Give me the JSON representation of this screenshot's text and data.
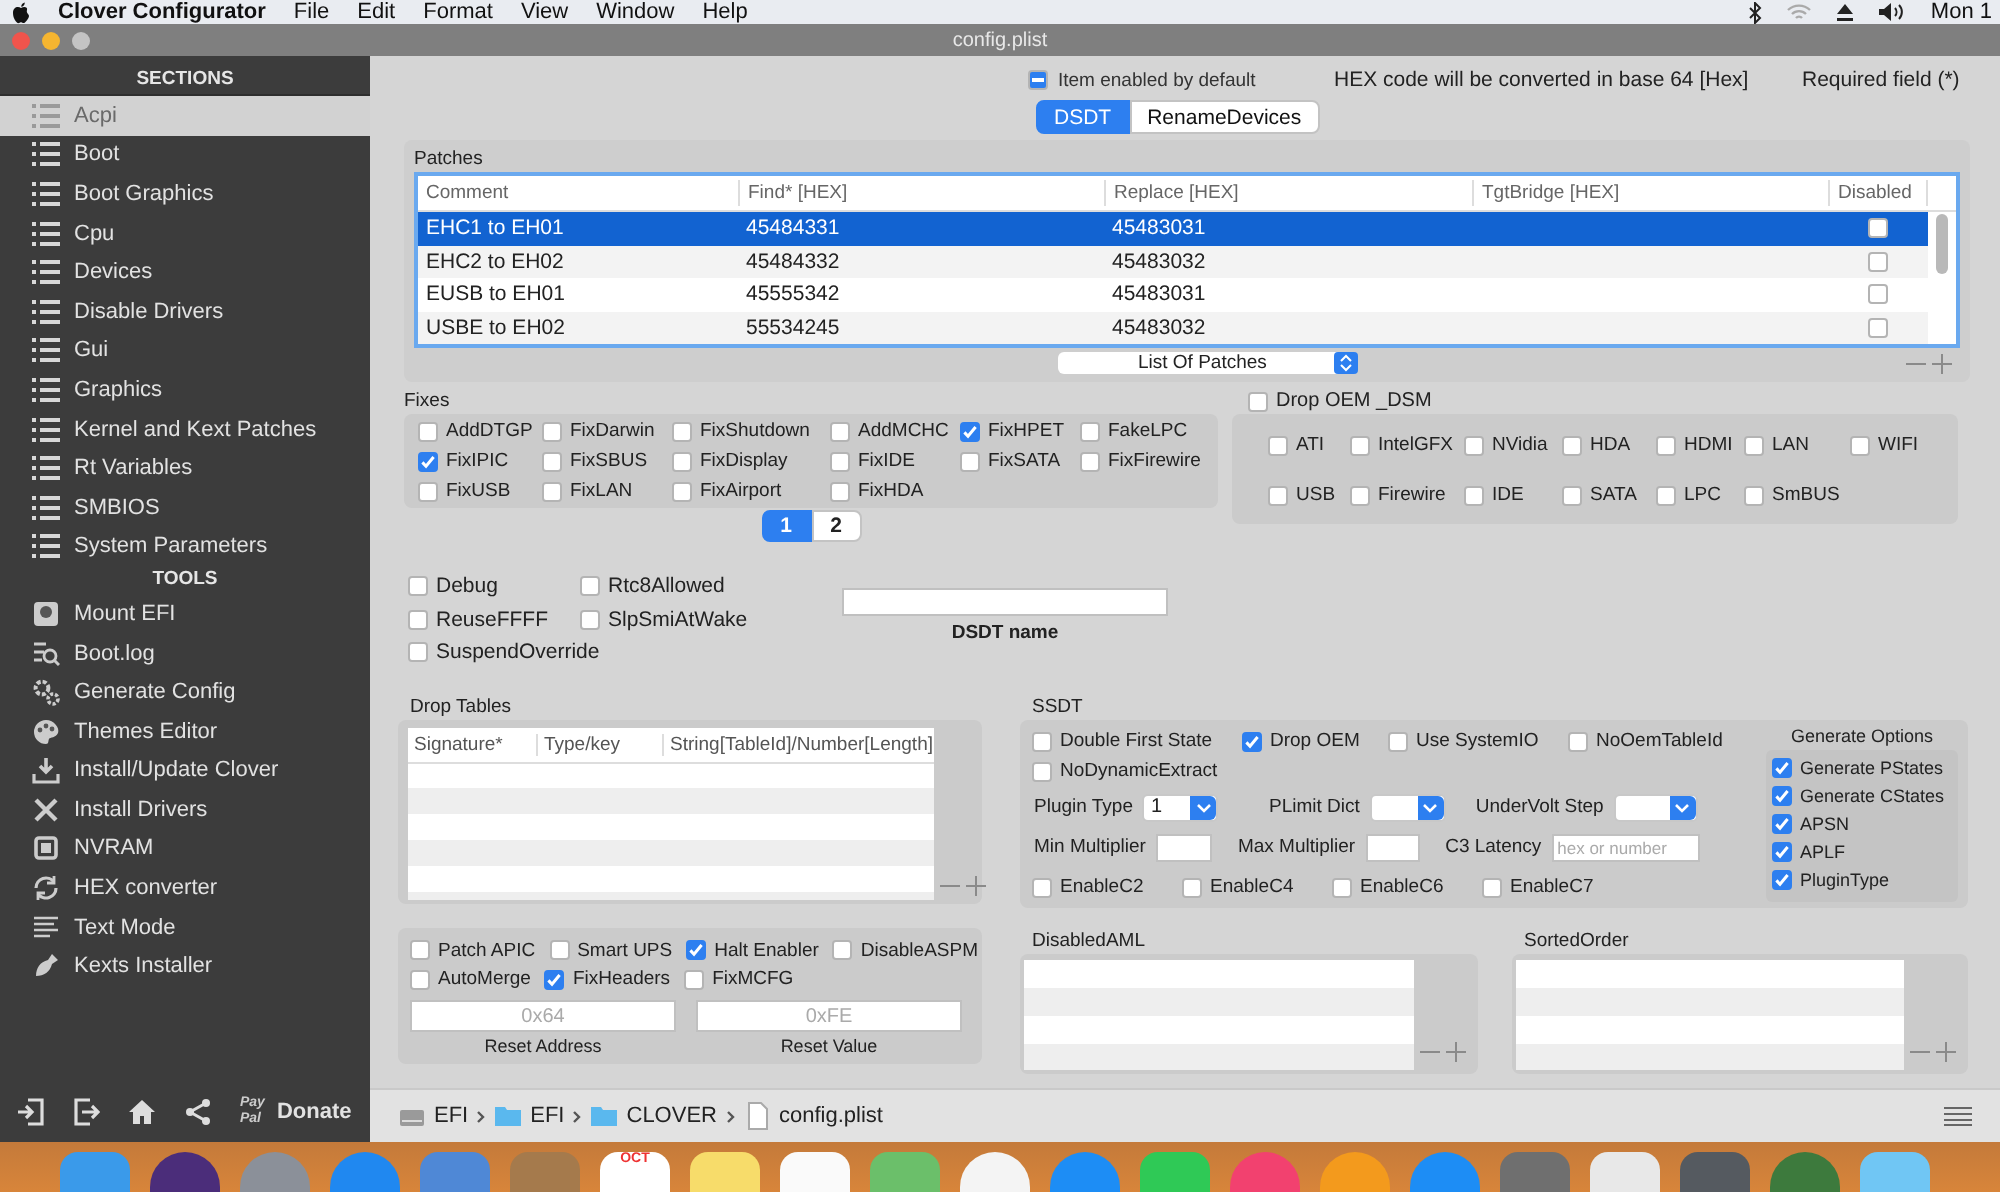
{
  "menu_bar": {
    "app": "Clover Configurator",
    "menus": [
      "File",
      "Edit",
      "Format",
      "View",
      "Window",
      "Help"
    ],
    "clock": "Mon 1"
  },
  "window": {
    "title": "config.plist"
  },
  "sidebar": {
    "sections_heading": "SECTIONS",
    "sections": [
      {
        "label": "Acpi",
        "selected": true
      },
      {
        "label": "Boot",
        "selected": false
      },
      {
        "label": "Boot Graphics",
        "selected": false
      },
      {
        "label": "Cpu",
        "selected": false
      },
      {
        "label": "Devices",
        "selected": false
      },
      {
        "label": "Disable Drivers",
        "selected": false
      },
      {
        "label": "Gui",
        "selected": false
      },
      {
        "label": "Graphics",
        "selected": false
      },
      {
        "label": "Kernel and Kext Patches",
        "selected": false
      },
      {
        "label": "Rt Variables",
        "selected": false
      },
      {
        "label": "SMBIOS",
        "selected": false
      },
      {
        "label": "System Parameters",
        "selected": false
      }
    ],
    "tools_heading": "TOOLS",
    "tools": [
      {
        "label": "Mount EFI",
        "kind": "disk"
      },
      {
        "label": "Boot.log",
        "kind": "log"
      },
      {
        "label": "Generate Config",
        "kind": "gears"
      },
      {
        "label": "Themes Editor",
        "kind": "palette"
      },
      {
        "label": "Install/Update Clover",
        "kind": "download"
      },
      {
        "label": "Install Drivers",
        "kind": "tools"
      },
      {
        "label": "NVRAM",
        "kind": "chip"
      },
      {
        "label": "HEX converter",
        "kind": "refresh"
      },
      {
        "label": "Text Mode",
        "kind": "lines"
      },
      {
        "label": "Kexts Installer",
        "kind": "plugin"
      }
    ],
    "footer": {
      "paypal": [
        "Pay",
        "Pal"
      ],
      "donate": "Donate"
    }
  },
  "header": {
    "item_enabled": {
      "label": "Item enabled by default",
      "mixed": true
    },
    "hex_note": "HEX code will be converted in base 64 [Hex]",
    "required_note": "Required field (*)"
  },
  "tabs": [
    {
      "label": "DSDT",
      "selected": true
    },
    {
      "label": "RenameDevices",
      "selected": false
    }
  ],
  "patches": {
    "title": "Patches",
    "columns": [
      "Comment",
      "Find* [HEX]",
      "Replace [HEX]",
      "TgtBridge [HEX]",
      "Disabled"
    ],
    "rows": [
      {
        "comment": "EHC1 to EH01",
        "find": "45484331",
        "replace": "45483031",
        "disabled": false,
        "selected": true
      },
      {
        "comment": "EHC2 to EH02",
        "find": "45484332",
        "replace": "45483032",
        "disabled": false,
        "selected": false
      },
      {
        "comment": "EUSB to EH01",
        "find": "45555342",
        "replace": "45483031",
        "disabled": false,
        "selected": false
      },
      {
        "comment": "USBE to EH02",
        "find": "55534245",
        "replace": "45483032",
        "disabled": false,
        "selected": false
      }
    ],
    "list_popup": "List Of Patches"
  },
  "fixes": {
    "title": "Fixes",
    "items": [
      {
        "label": "AddDTGP",
        "checked": false
      },
      {
        "label": "FixDarwin",
        "checked": false
      },
      {
        "label": "FixShutdown",
        "checked": false
      },
      {
        "label": "AddMCHC",
        "checked": false
      },
      {
        "label": "FixHPET",
        "checked": true
      },
      {
        "label": "FakeLPC",
        "checked": false
      },
      {
        "label": "FixIPIC",
        "checked": true
      },
      {
        "label": "FixSBUS",
        "checked": false
      },
      {
        "label": "FixDisplay",
        "checked": false
      },
      {
        "label": "FixIDE",
        "checked": false
      },
      {
        "label": "FixSATA",
        "checked": false
      },
      {
        "label": "FixFirewire",
        "checked": false
      },
      {
        "label": "FixUSB",
        "checked": false
      },
      {
        "label": "FixLAN",
        "checked": false
      },
      {
        "label": "FixAirport",
        "checked": false
      },
      {
        "label": "FixHDA",
        "checked": false
      }
    ],
    "pages": [
      {
        "label": "1",
        "selected": true
      },
      {
        "label": "2",
        "selected": false
      }
    ]
  },
  "drop_oem_dsm": {
    "label": "Drop OEM _DSM",
    "checked": false,
    "items": [
      {
        "label": "ATI",
        "checked": false
      },
      {
        "label": "IntelGFX",
        "checked": false
      },
      {
        "label": "NVidia",
        "checked": false
      },
      {
        "label": "HDA",
        "checked": false
      },
      {
        "label": "HDMI",
        "checked": false
      },
      {
        "label": "LAN",
        "checked": false
      },
      {
        "label": "WIFI",
        "checked": false
      },
      {
        "label": "USB",
        "checked": false
      },
      {
        "label": "Firewire",
        "checked": false
      },
      {
        "label": "IDE",
        "checked": false
      },
      {
        "label": "SATA",
        "checked": false
      },
      {
        "label": "LPC",
        "checked": false
      },
      {
        "label": "SmBUS",
        "checked": false
      }
    ]
  },
  "options": [
    {
      "label": "Debug",
      "checked": false
    },
    {
      "label": "Rtc8Allowed",
      "checked": false
    },
    {
      "label": "ReuseFFFF",
      "checked": false
    },
    {
      "label": "SlpSmiAtWake",
      "checked": false
    },
    {
      "label": "SuspendOverride",
      "checked": false
    }
  ],
  "dsdt_name": {
    "label": "DSDT name"
  },
  "drop_tables": {
    "title": "Drop Tables",
    "columns": [
      "Signature*",
      "Type/key",
      "String[TableId]/Number[Length]"
    ]
  },
  "misc": {
    "items": [
      {
        "label": "Patch APIC",
        "checked": false
      },
      {
        "label": "Smart UPS",
        "checked": false
      },
      {
        "label": "Halt Enabler",
        "checked": true
      },
      {
        "label": "DisableASPM",
        "checked": false
      },
      {
        "label": "AutoMerge",
        "checked": false
      },
      {
        "label": "FixHeaders",
        "checked": true
      },
      {
        "label": "FixMCFG",
        "checked": false
      }
    ],
    "reset_address": {
      "placeholder": "0x64",
      "label": "Reset Address"
    },
    "reset_value": {
      "placeholder": "0xFE",
      "label": "Reset Value"
    }
  },
  "ssdt": {
    "title": "SSDT",
    "flags": [
      {
        "label": "Double First State",
        "checked": false
      },
      {
        "label": "Drop OEM",
        "checked": true
      },
      {
        "label": "Use SystemIO",
        "checked": false
      },
      {
        "label": "NoOemTableId",
        "checked": false
      },
      {
        "label": "NoDynamicExtract",
        "checked": false
      }
    ],
    "plugin_type": {
      "label": "Plugin Type",
      "value": "1"
    },
    "plimit_dict": {
      "label": "PLimit Dict"
    },
    "undervolt_step": {
      "label": "UnderVolt Step"
    },
    "min_multiplier": {
      "label": "Min Multiplier"
    },
    "max_multiplier": {
      "label": "Max Multiplier"
    },
    "c3_latency": {
      "label": "C3 Latency",
      "placeholder": "hex or number"
    },
    "c_states": [
      {
        "label": "EnableC2",
        "checked": false
      },
      {
        "label": "EnableC4",
        "checked": false
      },
      {
        "label": "EnableC6",
        "checked": false
      },
      {
        "label": "EnableC7",
        "checked": false
      }
    ],
    "generate_options": {
      "title": "Generate Options",
      "items": [
        {
          "label": "Generate PStates",
          "checked": true
        },
        {
          "label": "Generate CStates",
          "checked": true
        },
        {
          "label": "APSN",
          "checked": true
        },
        {
          "label": "APLF",
          "checked": true
        },
        {
          "label": "PluginType",
          "checked": true
        }
      ]
    }
  },
  "disabled_aml": {
    "title": "DisabledAML"
  },
  "sorted_order": {
    "title": "SortedOrder"
  },
  "path_bar": {
    "crumbs": [
      {
        "label": "EFI",
        "kind": "drive"
      },
      {
        "label": "EFI",
        "kind": "folder"
      },
      {
        "label": "CLOVER",
        "kind": "folder"
      },
      {
        "label": "config.plist",
        "kind": "file"
      }
    ]
  },
  "dock": {
    "apps": [
      {
        "kind": "finder"
      },
      {
        "kind": "siri"
      },
      {
        "kind": "launchpad"
      },
      {
        "kind": "safari"
      },
      {
        "kind": "mail"
      },
      {
        "kind": "contacts"
      },
      {
        "kind": "calendar",
        "month": "OCT"
      },
      {
        "kind": "notes"
      },
      {
        "kind": "reminders"
      },
      {
        "kind": "maps"
      },
      {
        "kind": "photos"
      },
      {
        "kind": "messages"
      },
      {
        "kind": "facetime"
      },
      {
        "kind": "music"
      },
      {
        "kind": "books"
      },
      {
        "kind": "appstore"
      },
      {
        "kind": "settings"
      },
      {
        "kind": "utility"
      },
      {
        "kind": "tools"
      },
      {
        "kind": "clover"
      },
      {
        "kind": "folder"
      }
    ]
  }
}
